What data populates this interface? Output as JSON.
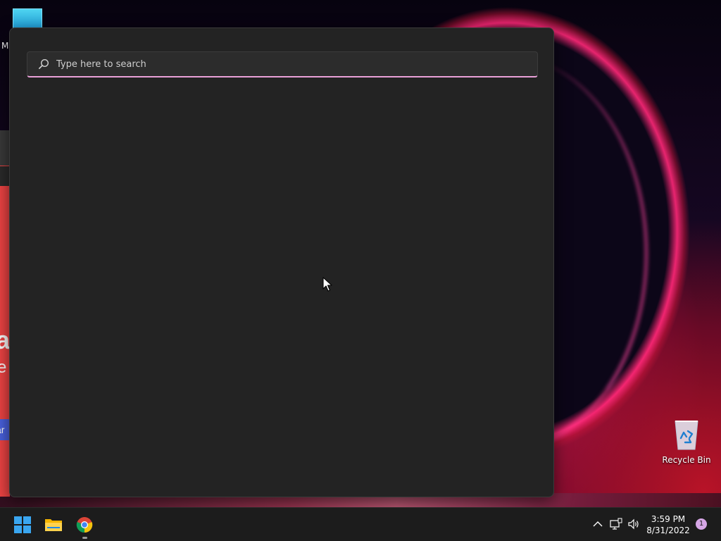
{
  "desktop": {
    "top_icon_label": "M",
    "recycle_bin_label": "Recycle Bin"
  },
  "background_window": {
    "peek_text_large": "a",
    "peek_text_medium": "e",
    "peek_button_text": "ar"
  },
  "search": {
    "placeholder": "Type here to search",
    "value": "",
    "accent_color": "#e9a0d8"
  },
  "taskbar": {
    "apps": [
      {
        "name": "Start",
        "icon": "windows-logo-icon"
      },
      {
        "name": "File Explorer",
        "icon": "folder-icon"
      },
      {
        "name": "Google Chrome",
        "icon": "chrome-icon"
      }
    ],
    "tray": {
      "time": "3:59 PM",
      "date": "8/31/2022",
      "notification_count": "1"
    }
  }
}
